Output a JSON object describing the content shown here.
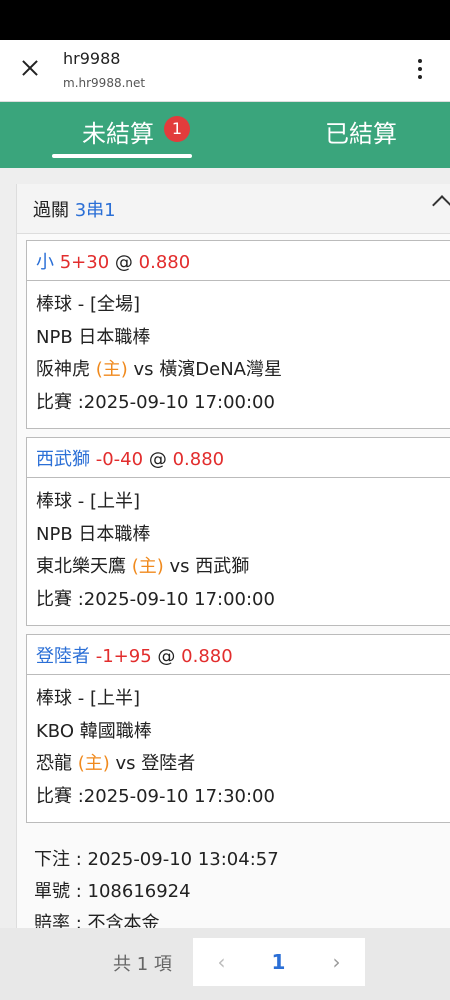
{
  "browser": {
    "title": "hr9988",
    "url": "m.hr9988.net"
  },
  "tabs": {
    "unsettled_label": "未結算",
    "unsettled_badge": "1",
    "settled_label": "已結算"
  },
  "bet": {
    "type_label": "過關",
    "parlay": "3串1",
    "legs": [
      {
        "pick": "小",
        "line": "5+30",
        "at": "@",
        "odds": "0.880",
        "sport": "棒球 - [全場]",
        "league": "NPB 日本職棒",
        "home": "阪神虎",
        "home_tag": "(主)",
        "vs": "vs",
        "away": "橫濱DeNA灣星",
        "match_time": "比賽 :2025-09-10 17:00:00"
      },
      {
        "pick": "西武獅",
        "line": "-0-40",
        "at": "@",
        "odds": "0.880",
        "sport": "棒球 - [上半]",
        "league": "NPB 日本職棒",
        "home": "東北樂天鷹",
        "home_tag": "(主)",
        "vs": "vs",
        "away": "西武獅",
        "match_time": "比賽 :2025-09-10 17:00:00"
      },
      {
        "pick": "登陸者",
        "line": "-1+95",
        "at": "@",
        "odds": "0.880",
        "sport": "棒球 - [上半]",
        "league": "KBO 韓國職棒",
        "home": "恐龍",
        "home_tag": "(主)",
        "vs": "vs",
        "away": "登陸者",
        "match_time": "比賽 :2025-09-10 17:30:00"
      }
    ],
    "placed": "下注 : 2025-09-10 13:04:57",
    "ticket": "單號 : 108616924",
    "payout": "賠率 : 不含本金"
  },
  "pager": {
    "count": "共 1 項",
    "prev": "‹",
    "current": "1",
    "next": "›"
  },
  "colors": {
    "header_green": "#3aa57c",
    "badge_red": "#e23c3c",
    "link_blue": "#2b6fd6",
    "odds_red": "#e22d2d",
    "home_orange": "#f08a1e"
  }
}
